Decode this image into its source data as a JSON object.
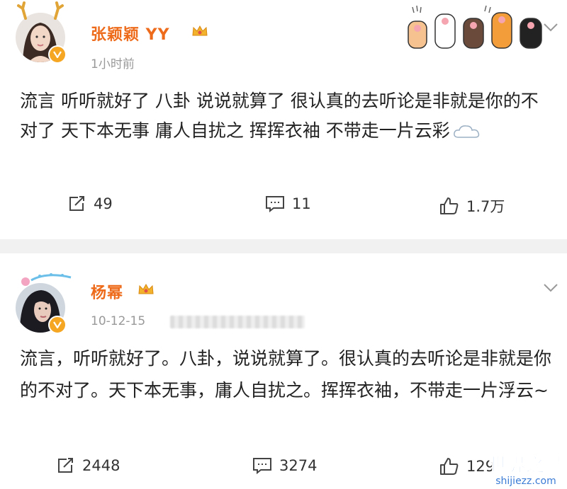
{
  "post1": {
    "username": "张颖颖 YY",
    "timestamp": "1小时前",
    "content": "流言 听听就好了 八卦 说说就算了 很认真的去听论是非就是你的不对了 天下本无事 庸人自扰之 挥挥衣袖 不带走一片云彩",
    "repost_count": "49",
    "comment_count": "11",
    "like_count": "1.7万"
  },
  "post2": {
    "username": "杨幂",
    "timestamp": "10-12-15",
    "content": "流言，听听就好了。八卦，说说就算了。很认真的去听论是非就是你的不对了。天下本无事，庸人自扰之。挥挥衣袖，不带走一片浮云~",
    "repost_count": "2448",
    "comment_count": "3274",
    "like_count": "129"
  },
  "icons": {
    "repost": "repost-icon",
    "comment": "comment-icon",
    "like": "thumbs-up-icon",
    "verified": "verified-badge-icon",
    "crown": "crown-icon",
    "cloud": "cloud-emoji-icon",
    "more": "chevron-down-icon"
  },
  "watermark": {
    "title": "世界之最",
    "url": "shijiezz.com"
  },
  "colors": {
    "username": "#ed6b1b",
    "verified": "#f5a623",
    "watermark": "#3a7bd5",
    "separator": "#f1f1f1"
  }
}
